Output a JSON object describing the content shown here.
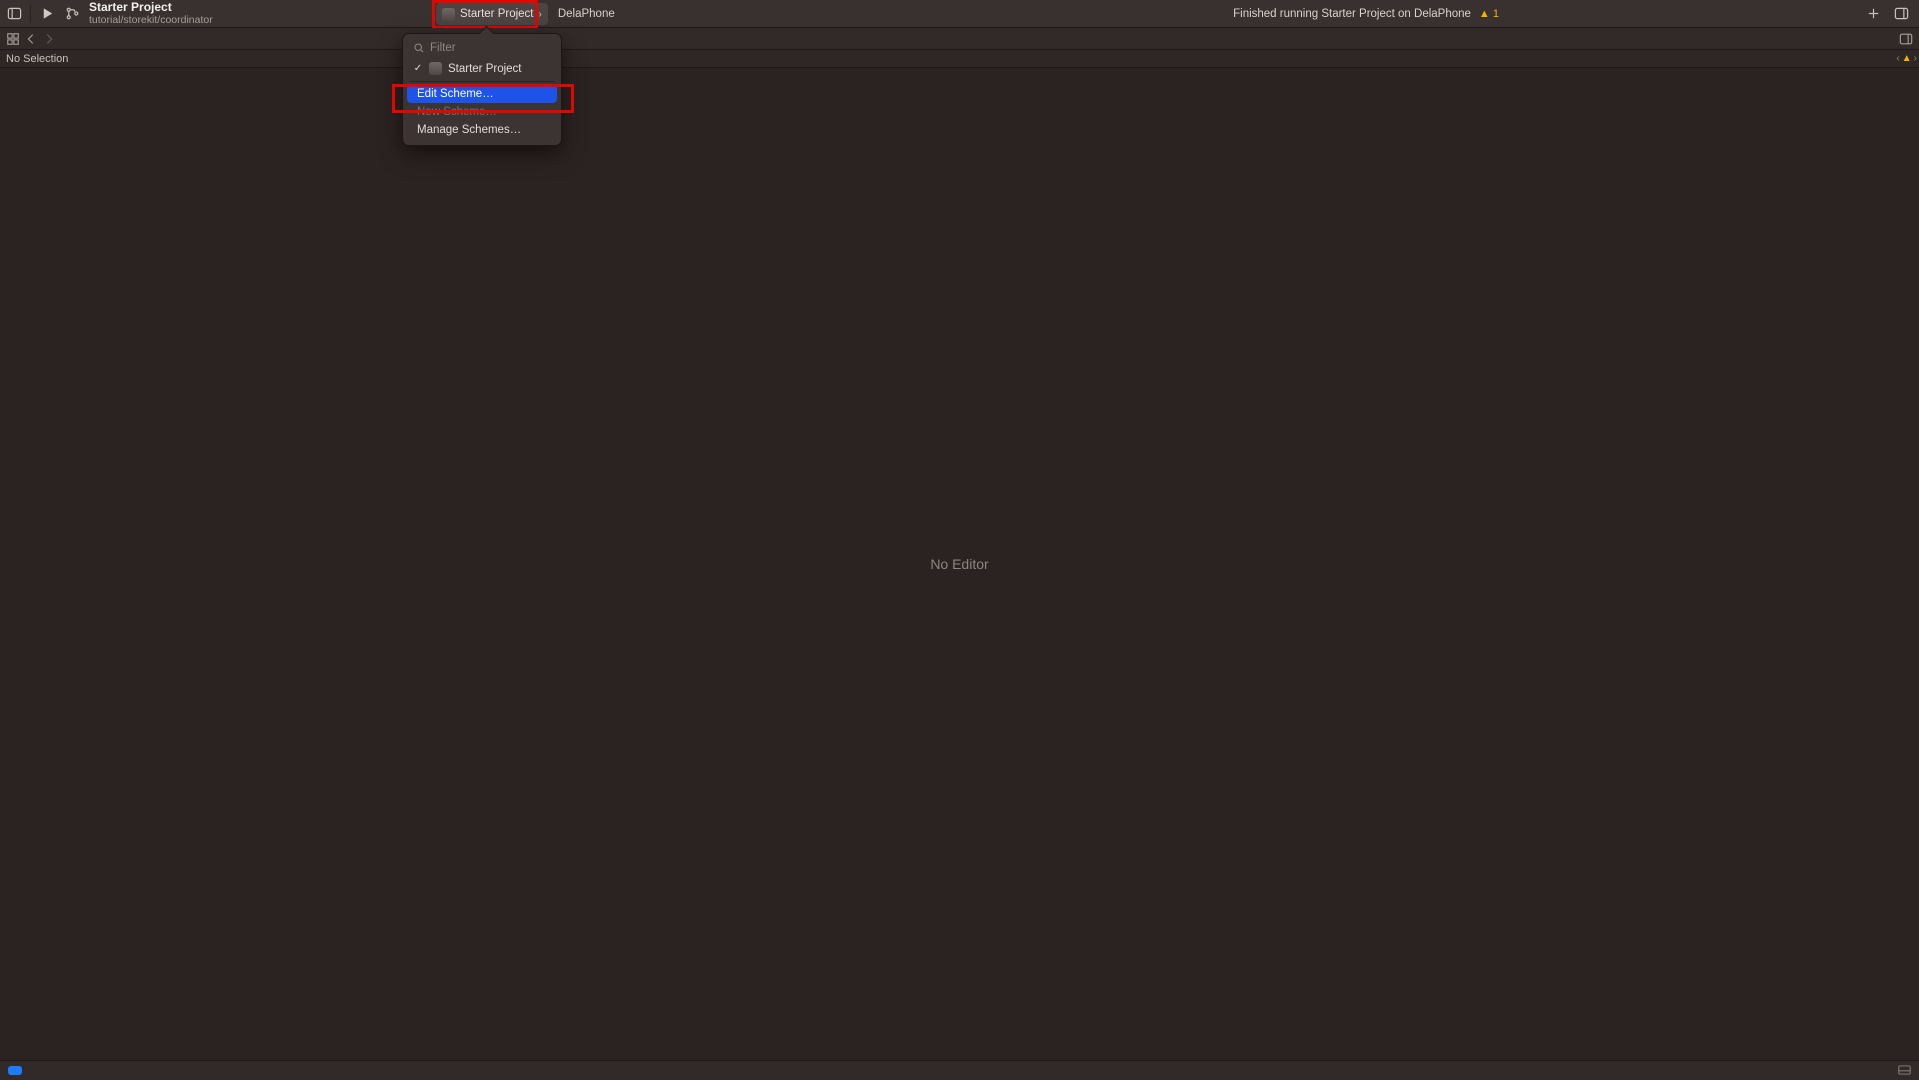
{
  "toolbar": {
    "project_name": "Starter Project",
    "project_sub": "tutorial/storekit/coordinator",
    "scheme_label": "Starter Project",
    "destination_label": "DelaPhone",
    "status_text": "Finished running Starter Project on DelaPhone",
    "warning_count": "1"
  },
  "selection": {
    "text": "No Selection"
  },
  "editor": {
    "placeholder": "No Editor"
  },
  "popover": {
    "filter_placeholder": "Filter",
    "scheme_item": "Starter Project",
    "edit_scheme": "Edit Scheme…",
    "new_scheme": "New Scheme…",
    "manage_schemes": "Manage Schemes…"
  }
}
